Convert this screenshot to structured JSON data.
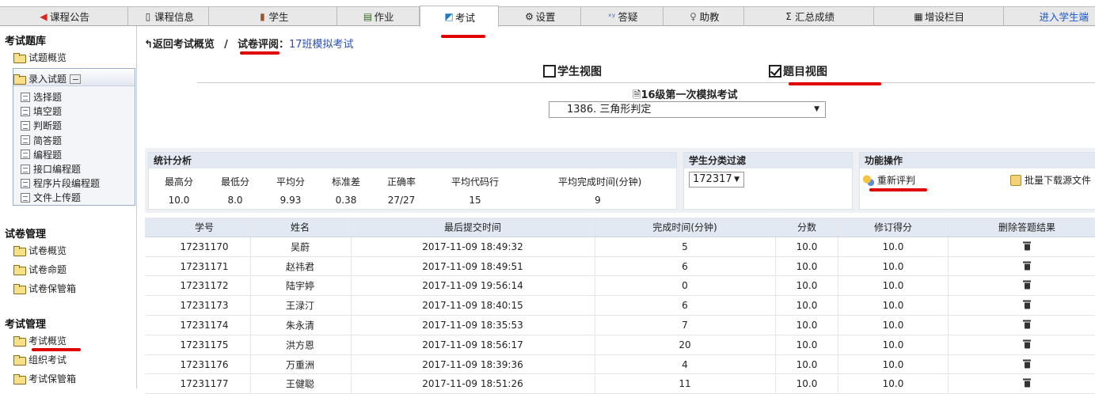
{
  "nav": {
    "tabs": [
      {
        "label": "课程公告",
        "icon": "speaker-icon",
        "color": "#d9261c"
      },
      {
        "label": "课程信息",
        "icon": "book-icon",
        "color": "#333"
      },
      {
        "label": "学生",
        "icon": "students-icon",
        "color": "#a0522d"
      },
      {
        "label": "作业",
        "icon": "homework-icon",
        "color": "#3a6b2a"
      },
      {
        "label": "考试",
        "icon": "exam-icon",
        "color": "#1f7ac2"
      },
      {
        "label": "设置",
        "icon": "gear-icon",
        "color": "#222"
      },
      {
        "label": "答疑",
        "icon": "formula-icon",
        "color": "#4a67b0"
      },
      {
        "label": "助教",
        "icon": "assistant-icon",
        "color": "#666"
      },
      {
        "label": "汇总成绩",
        "icon": "sigma-icon",
        "color": "#222"
      },
      {
        "label": "增设栏目",
        "icon": "grid-icon",
        "color": "#222"
      }
    ],
    "student_link": "进入学生端",
    "active_tab": "考试"
  },
  "sidebar": {
    "section1": {
      "title": "考试题库",
      "items": [
        "试题概览",
        "录入试题"
      ]
    },
    "subitems": [
      "选择题",
      "填空题",
      "判断题",
      "简答题",
      "编程题",
      "接口编程题",
      "程序片段编程题",
      "文件上传题"
    ],
    "section2": {
      "title": "试卷管理",
      "items": [
        "试卷概览",
        "试卷命题",
        "试卷保管箱"
      ]
    },
    "section3": {
      "title": "考试管理",
      "items": [
        "考试概览",
        "组织考试",
        "考试保管箱"
      ]
    }
  },
  "breadcrumb": {
    "back": "返回考试概览",
    "separator": "/",
    "current": "试卷评阅",
    "colon": "：",
    "exam_name": "17班模拟考试"
  },
  "views": {
    "student_view": "学生视图",
    "question_view": "题目视图",
    "question_view_checked": true,
    "student_view_checked": false
  },
  "exam_title": "16级第一次模拟考试",
  "question_select": {
    "selected": "1386. 三角形判定"
  },
  "stats": {
    "title": "统计分析",
    "headers": [
      "最高分",
      "最低分",
      "平均分",
      "标准差",
      "正确率",
      "平均代码行",
      "平均完成时间(分钟)"
    ],
    "values": [
      "10.0",
      "8.0",
      "9.93",
      "0.38",
      "27/27",
      "15",
      "9"
    ]
  },
  "filter": {
    "title": "学生分类过滤",
    "selected": "172317"
  },
  "functions": {
    "title": "功能操作",
    "regrade": "重新评判",
    "download": "批量下载源文件"
  },
  "table": {
    "headers": [
      "学号",
      "姓名",
      "最后提交时间",
      "完成时间(分钟)",
      "分数",
      "修订得分",
      "删除答题结果"
    ],
    "rows": [
      [
        "17231170",
        "吴蔚",
        "2017-11-09 18:49:32",
        "5",
        "10.0",
        "10.0"
      ],
      [
        "17231171",
        "赵祎君",
        "2017-11-09 18:49:51",
        "6",
        "10.0",
        "10.0"
      ],
      [
        "17231172",
        "陆宇婷",
        "2017-11-09 19:56:14",
        "0",
        "10.0",
        "10.0"
      ],
      [
        "17231173",
        "王渌汀",
        "2017-11-09 18:40:15",
        "6",
        "10.0",
        "10.0"
      ],
      [
        "17231174",
        "朱永清",
        "2017-11-09 18:35:53",
        "7",
        "10.0",
        "10.0"
      ],
      [
        "17231175",
        "洪方恩",
        "2017-11-09 18:56:17",
        "20",
        "10.0",
        "10.0"
      ],
      [
        "17231176",
        "万重洲",
        "2017-11-09 18:39:36",
        "4",
        "10.0",
        "10.0"
      ],
      [
        "17231177",
        "王健聪",
        "2017-11-09 18:51:26",
        "11",
        "10.0",
        "10.0"
      ]
    ]
  }
}
